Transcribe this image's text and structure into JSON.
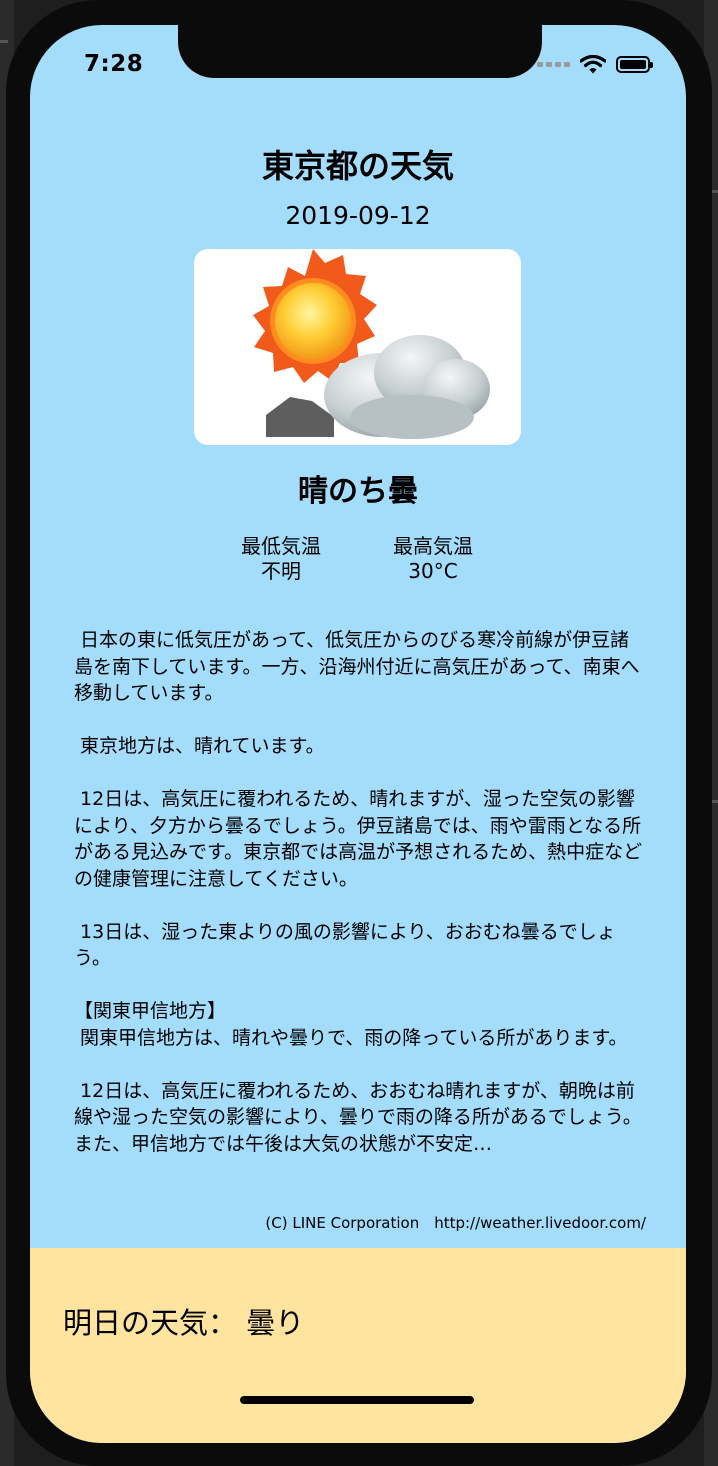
{
  "status_bar": {
    "time": "7:28"
  },
  "weather": {
    "title": "東京都の天気",
    "date": "2019-09-12",
    "image_icon": "sun-then-cloud-icon",
    "telop": "晴のち曇",
    "min_temp_label": "最低気温",
    "min_temp_value": "不明",
    "max_temp_label": "最高気温",
    "max_temp_value": "30°C",
    "description": " 日本の東に低気圧があって、低気圧からのびる寒冷前線が伊豆諸島を南下しています。一方、沿海州付近に高気圧があって、南東へ移動しています。\n\n 東京地方は、晴れています。\n\n 12日は、高気圧に覆われるため、晴れますが、湿った空気の影響により、夕方から曇るでしょう。伊豆諸島では、雨や雷雨となる所がある見込みです。東京都では高温が予想されるため、熱中症などの健康管理に注意してください。\n\n 13日は、湿った東よりの風の影響により、おおむね曇るでしょう。\n\n【関東甲信地方】\n 関東甲信地方は、晴れや曇りで、雨の降っている所があります。\n\n 12日は、高気圧に覆われるため、おおむね晴れますが、朝晩は前線や湿った空気の影響により、曇りで雨の降る所があるでしょう。また、甲信地方では午後は大気の状態が不安定…",
    "copyright": "(C) LINE Corporation　http://weather.livedoor.com/"
  },
  "tomorrow": {
    "text": "明日の天気： 曇り"
  },
  "colors": {
    "screen_background": "#a4dcfb",
    "tomorrow_background": "#ffe4a0"
  }
}
